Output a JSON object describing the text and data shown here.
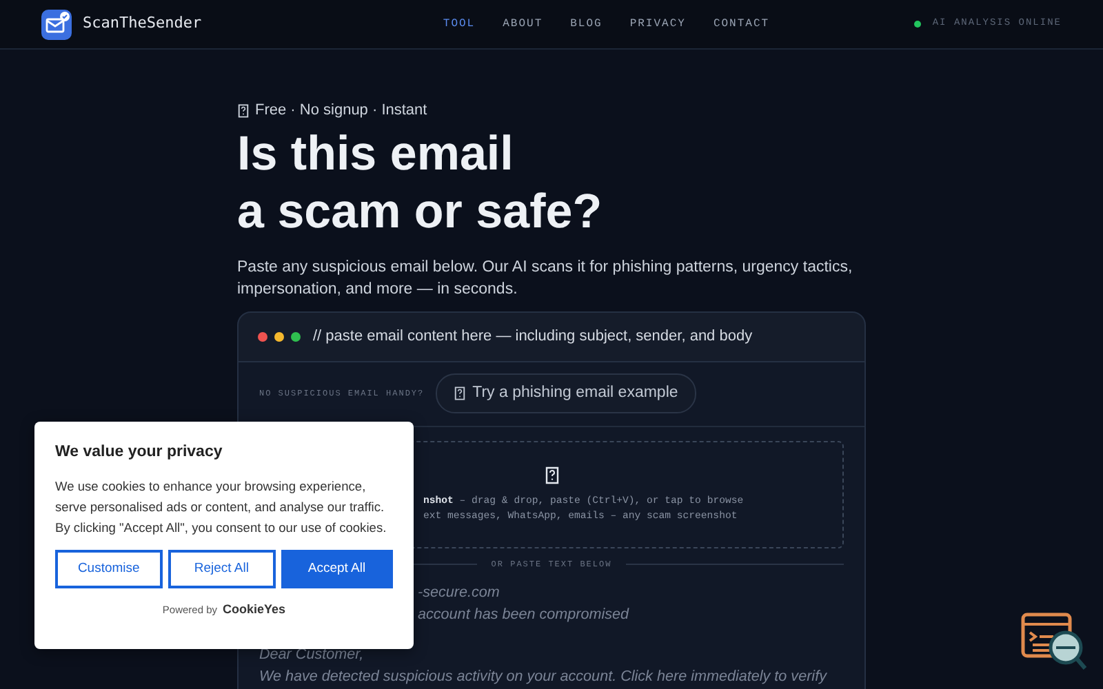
{
  "brand": {
    "name": "ScanTheSender"
  },
  "nav": [
    {
      "label": "TOOL",
      "selected": true
    },
    {
      "label": "ABOUT",
      "selected": false
    },
    {
      "label": "BLOG",
      "selected": false
    },
    {
      "label": "PRIVACY",
      "selected": false
    },
    {
      "label": "CONTACT",
      "selected": false
    }
  ],
  "status": {
    "label": "AI ANALYSIS ONLINE"
  },
  "hero": {
    "tagline": "Free · No signup · Instant",
    "title_lines": [
      "Is this email",
      "a scam or safe?"
    ],
    "subtitle": "Paste any suspicious email below. Our AI scans it for phishing patterns, urgency tactics, impersonation, and more — in seconds."
  },
  "input_card": {
    "header": "// paste email content here — including subject, sender, and body",
    "example_label": "NO SUSPICIOUS EMAIL HANDY?",
    "example_button": "Try a phishing email example",
    "drop_zone_lines": [
      "**nshot** – drag & drop, paste (Ctrl+V), or tap to browse",
      "ext messages, WhatsApp, emails – any scam screenshot"
    ],
    "divider": "OR PASTE TEXT BELOW",
    "textarea_lines": [
      {
        "text": "-secure.com",
        "partial": true
      },
      {
        "text": "account has been compromised",
        "partial": true
      },
      {
        "text": "Dear Customer,",
        "partial": false
      },
      {
        "text": "We have detected suspicious activity on your account. Click here immediately to verify",
        "partial": false
      }
    ]
  },
  "cookie_banner": {
    "title": "We value your privacy",
    "text": "We use cookies to enhance your browsing experience, serve personalised ads or content, and analyse our traffic. By clicking \"Accept All\", you consent to our use of cookies.",
    "buttons": [
      {
        "label": "Customise",
        "kind": "outline"
      },
      {
        "label": "Reject All",
        "kind": "outline"
      },
      {
        "label": "Accept All",
        "kind": "primary"
      }
    ],
    "powered_by": "Powered by",
    "powered_brand": "CookieYes"
  }
}
